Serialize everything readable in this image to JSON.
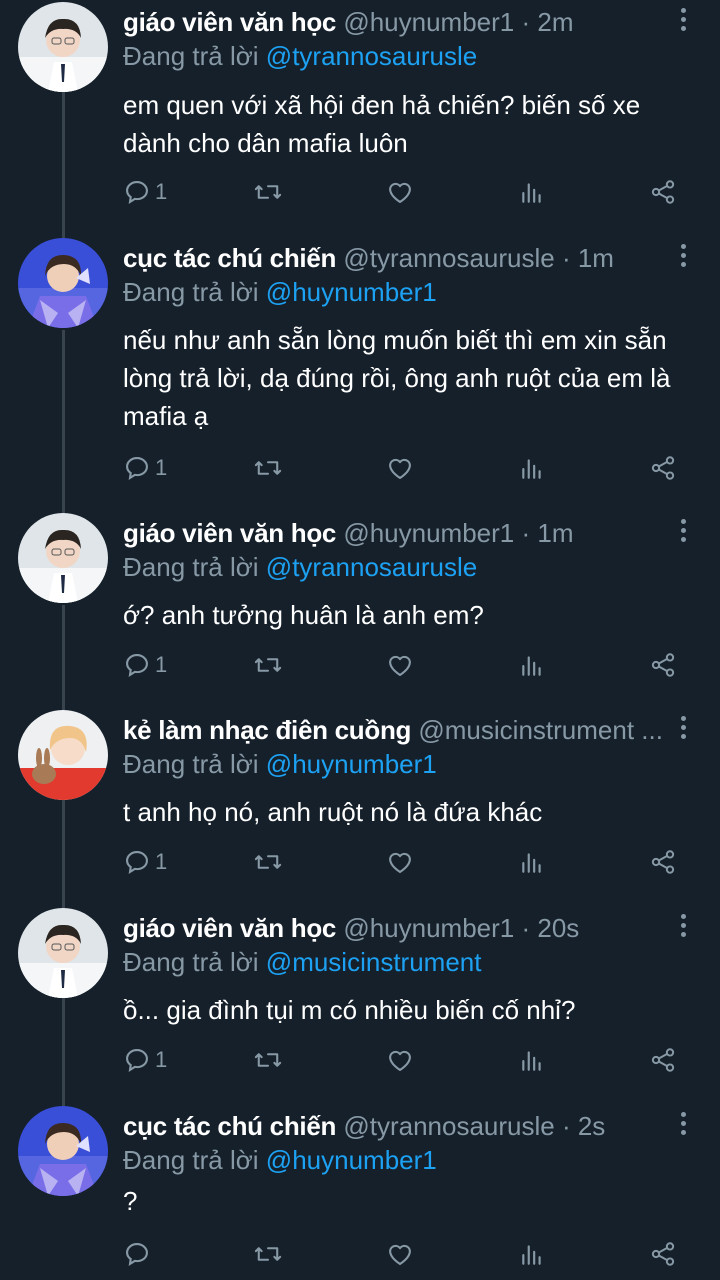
{
  "tweets": [
    {
      "name": "giáo viên văn học",
      "handle": "@huynumber1",
      "time": "· 2m",
      "reply_prefix": "Đang trả lời",
      "reply_to": "@tyrannosaurusle",
      "lines": [
        "em quen với xã hội đen hả chiến? biến số xe",
        "dành cho dân mafia luôn"
      ],
      "reply_count": "1",
      "avatar": "avatar-huynumber1"
    },
    {
      "name": "cục tác chú chiến",
      "handle": "@tyrannosaurusle",
      "time": "· 1m",
      "reply_prefix": "Đang trả lời",
      "reply_to": "@huynumber1",
      "lines": [
        "nếu như anh sẵn lòng muốn biết thì em xin sẵn",
        "lòng trả lời, dạ đúng rồi, ông anh ruột của em là",
        "mafia ạ"
      ],
      "reply_count": "1",
      "avatar": "avatar-tyrannosaurusle"
    },
    {
      "name": "giáo viên văn học",
      "handle": "@huynumber1",
      "time": "· 1m",
      "reply_prefix": "Đang trả lời",
      "reply_to": "@tyrannosaurusle",
      "lines": [
        "ớ? anh tưởng huân là anh em?"
      ],
      "reply_count": "1",
      "avatar": "avatar-huynumber1"
    },
    {
      "name": "kẻ làm nhạc điên cuồng",
      "handle": "@musicinstrument ...",
      "time": "",
      "reply_prefix": "Đang trả lời",
      "reply_to": "@huynumber1",
      "lines": [
        "t anh họ nó, anh ruột nó là đứa khác"
      ],
      "reply_count": "1",
      "avatar": "avatar-musicinstrument"
    },
    {
      "name": "giáo viên văn học",
      "handle": "@huynumber1",
      "time": "· 20s",
      "reply_prefix": "Đang trả lời",
      "reply_to": "@musicinstrument",
      "lines": [
        "ồ... gia đình tụi m có nhiều biến cố nhỉ?"
      ],
      "reply_count": "1",
      "avatar": "avatar-huynumber1"
    },
    {
      "name": "cục tác chú chiến",
      "handle": "@tyrannosaurusle",
      "time": "· 2s",
      "reply_prefix": "Đang trả lời",
      "reply_to": "@huynumber1",
      "lines": [
        "?"
      ],
      "reply_count": "",
      "avatar": "avatar-tyrannosaurusle"
    }
  ],
  "icons": [
    "reply-icon",
    "retweet-icon",
    "like-icon",
    "analytics-icon",
    "share-icon",
    "more-icon"
  ],
  "colors": {
    "background": "#15202b",
    "text": "#ffffff",
    "muted": "#8899a6",
    "mention": "#1da1f2",
    "line": "#38444d"
  }
}
